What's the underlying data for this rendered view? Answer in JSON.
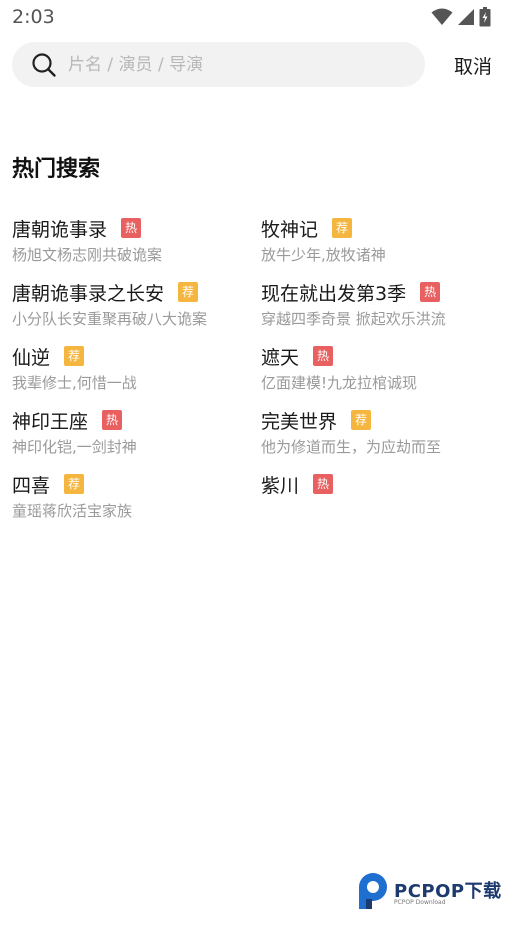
{
  "status_bar": {
    "time": "2:03"
  },
  "search": {
    "placeholder": "片名 / 演员 / 导演",
    "value": "",
    "cancel_label": "取消"
  },
  "section": {
    "title": "热门搜索"
  },
  "badges": {
    "hot": "热",
    "rec": "荐"
  },
  "hot_searches": [
    {
      "title": "唐朝诡事录",
      "badge": "热",
      "subtitle": "杨旭文杨志刚共破诡案"
    },
    {
      "title": "牧神记",
      "badge": "荐",
      "subtitle": "放牛少年,放牧诸神"
    },
    {
      "title": "唐朝诡事录之长安",
      "badge": "荐",
      "subtitle": "小分队长安重聚再破八大诡案"
    },
    {
      "title": "现在就出发第3季",
      "badge": "热",
      "subtitle": "穿越四季奇景 掀起欢乐洪流"
    },
    {
      "title": "仙逆",
      "badge": "荐",
      "subtitle": "我辈修士,何惜一战"
    },
    {
      "title": "遮天",
      "badge": "热",
      "subtitle": "亿面建模!九龙拉棺诚现"
    },
    {
      "title": "神印王座",
      "badge": "热",
      "subtitle": "神印化铠,一剑封神"
    },
    {
      "title": "完美世界",
      "badge": "荐",
      "subtitle": "他为修道而生，为应劫而至"
    },
    {
      "title": "四喜",
      "badge": "荐",
      "subtitle": "童瑶蒋欣活宝家族"
    },
    {
      "title": "紫川",
      "badge": "热",
      "subtitle": ""
    }
  ],
  "colors": {
    "hot_badge": "#e86060",
    "rec_badge": "#f5b640",
    "search_bg": "#f2f2f2"
  },
  "watermark": {
    "brand": "PCPOP下载",
    "sub": "PCPOP Download"
  }
}
